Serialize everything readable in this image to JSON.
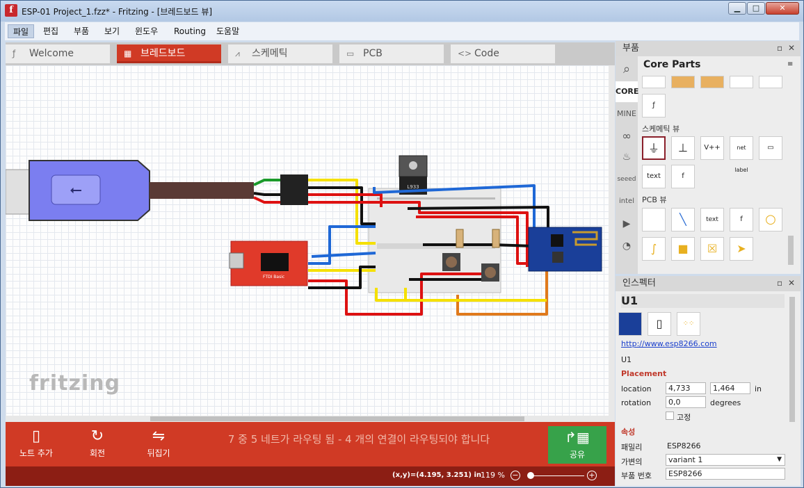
{
  "window": {
    "title": "ESP-01 Project_1.fzz* - Fritzing - [브레드보드 뷰]",
    "app_icon": "f"
  },
  "menu": {
    "items": [
      "파일",
      "편집",
      "부품",
      "보기",
      "윈도우",
      "Routing",
      "도움말"
    ]
  },
  "tabs": [
    {
      "label": "Welcome",
      "icon": "fritzing-f-icon",
      "glyph": "ƒ"
    },
    {
      "label": "브레드보드",
      "icon": "breadboard-icon",
      "glyph": "▦"
    },
    {
      "label": "스케메틱",
      "icon": "schematic-icon",
      "glyph": "⩘"
    },
    {
      "label": "PCB",
      "icon": "pcb-icon",
      "glyph": "▭"
    },
    {
      "label": "Code",
      "icon": "code-icon",
      "glyph": "<>"
    }
  ],
  "canvas": {
    "logo_text": "fritzing",
    "parts": {
      "regulator_label": "L933",
      "ftdi_label": "FTDI Basic"
    }
  },
  "toolbar": {
    "add_note": "노트 추가",
    "rotate": "회전",
    "flip": "뒤집기",
    "share": "공유",
    "routing_status": "7 중 5 네트가 라우팅 됨 - 4 개의 연결이 라우팅되야 합니다"
  },
  "status": {
    "coords": "(x,y)=(4.195, 3.251) in",
    "zoom": "119 %"
  },
  "parts_bin": {
    "panel_title": "부품",
    "bin_title": "Core Parts",
    "side_tabs": [
      "CORE",
      "MINE"
    ],
    "schematic_section": "스케메틱 뷰",
    "pcb_section": "PCB 뷰",
    "schematic_parts": [
      "ground-icon",
      "battery-icon",
      "V++",
      "net label",
      "frame-icon",
      "text",
      "f"
    ],
    "pcb_parts": [
      "blank",
      "jumper",
      "text",
      "f",
      "hole",
      "via",
      "pad",
      "square-pad",
      "arrow"
    ]
  },
  "inspector": {
    "panel_title": "인스펙터",
    "part_title": "U1",
    "url": "http://www.esp8266.com",
    "part_name": "U1",
    "placement_label": "Placement",
    "location_label": "location",
    "location_x": "4,733",
    "location_y": "1,464",
    "location_unit": "in",
    "rotation_label": "rotation",
    "rotation_value": "0,0",
    "rotation_unit": "degrees",
    "lock_label": "고정",
    "props_label": "속성",
    "family_label": "패밀리",
    "family_value": "ESP8266",
    "variant_label": "가변의",
    "variant_value": "variant 1",
    "partno_label": "부품 번호",
    "partno_value": "ESP8266"
  },
  "colors": {
    "accent": "#d03a25",
    "share": "#37a24a",
    "status": "#8c1e14",
    "usb": "#7b7ef0"
  }
}
